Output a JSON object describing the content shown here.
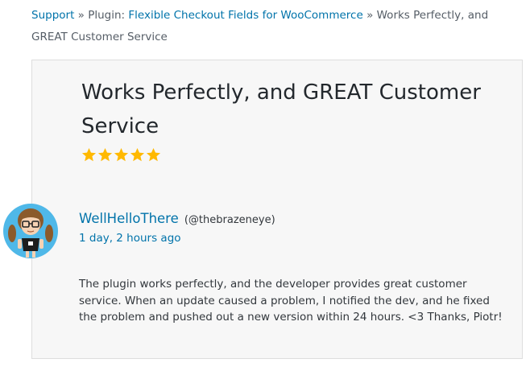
{
  "breadcrumb": {
    "support": "Support",
    "sep1": " » ",
    "plugin_prefix": "Plugin: ",
    "plugin_name": "Flexible Checkout Fields for WooCommerce",
    "sep2": " » ",
    "current": "Works Perfectly, and GREAT Customer Service"
  },
  "review": {
    "title": "Works Perfectly, and GREAT Customer Service",
    "rating": {
      "value": 5,
      "max": 5,
      "star_color": "#ffb900"
    },
    "author": {
      "display_name": "WellHelloThere",
      "username": "(@thebrazeneye)",
      "avatar_icon": "avatar-girl-with-glasses-icon"
    },
    "date": "1 day, 2 hours ago",
    "body": "The plugin works perfectly, and the developer provides great customer service. When an update caused a problem, I notified the dev, and he fixed the problem and pushed out a new version within 24 hours. <3 Thanks, Piotr!"
  },
  "colors": {
    "link": "#0073aa",
    "card_background": "#f7f7f7",
    "card_border": "#dedede",
    "text": "#32373c",
    "avatar_background": "#4fb8e8"
  }
}
